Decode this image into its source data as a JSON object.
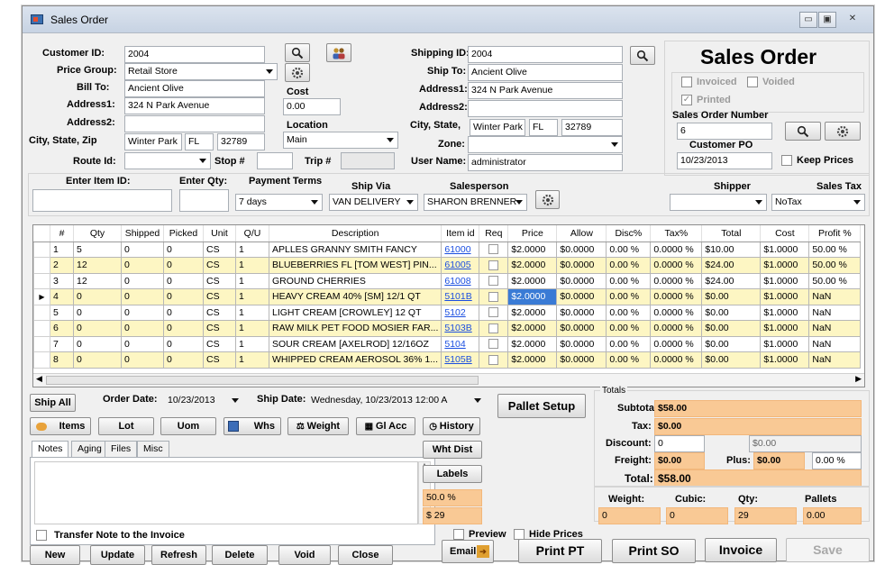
{
  "window": {
    "title": "Sales Order",
    "min_label": "▭",
    "max_label": "▣",
    "close_label": "✕"
  },
  "customer": {
    "id_label": "Customer ID:",
    "id": "2004",
    "price_group_label": "Price Group:",
    "price_group": "Retail Store",
    "bill_to_label": "Bill To:",
    "bill_to": "Ancient Olive",
    "address1_label": "Address1:",
    "address1": "324 N Park Avenue",
    "address2_label": "Address2:",
    "address2": "",
    "csz_label": "City, State, Zip",
    "city": "Winter Park",
    "state": "FL",
    "zip": "32789",
    "route_label": "Route Id:",
    "route": "",
    "stop_label": "Stop #",
    "stop": "",
    "trip_label": "Trip #",
    "trip": ""
  },
  "cost": {
    "label": "Cost",
    "value": "0.00",
    "location_label": "Location",
    "location": "Main"
  },
  "shipping": {
    "id_label": "Shipping ID:",
    "id": "2004",
    "ship_to_label": "Ship To:",
    "ship_to": "Ancient Olive",
    "address1_label": "Address1:",
    "address1": "324 N Park Avenue",
    "address2_label": "Address2:",
    "address2": "",
    "csz_label": "City, State,",
    "city": "Winter Park",
    "state": "FL",
    "zip": "32789",
    "zone_label": "Zone:",
    "zone": "",
    "username_label": "User Name:",
    "username": "administrator"
  },
  "order_panel": {
    "heading": "Sales Order",
    "invoiced": "Invoiced",
    "voided": "Voided",
    "printed": "Printed",
    "number_label": "Sales Order Number",
    "number": "6",
    "customer_po_label": "Customer PO",
    "customer_po": "10/23/2013",
    "keep_prices": "Keep Prices"
  },
  "entry": {
    "item_label": "Enter Item ID:",
    "qty_label": "Enter Qty:",
    "terms_label": "Payment Terms",
    "terms": "7 days",
    "ship_via_label": "Ship Via",
    "ship_via": "VAN DELIVERY",
    "salesperson_label": "Salesperson",
    "salesperson": "SHARON BRENNER",
    "shipper_label": "Shipper",
    "shipper": "",
    "sales_tax_label": "Sales Tax",
    "sales_tax": "NoTax"
  },
  "grid": {
    "columns": [
      "#",
      "Qty",
      "Shipped",
      "Picked",
      "Unit",
      "Q/U",
      "Description",
      "Item id",
      "Req",
      "Price",
      "Allow",
      "Disc%",
      "Tax%",
      "Total",
      "Cost",
      "Profit %"
    ],
    "rows": [
      [
        "1",
        "5",
        "0",
        "0",
        "CS",
        "1",
        "APLLES GRANNY SMITH FANCY",
        "61000",
        "",
        "$2.0000",
        "$0.0000",
        "0.00 %",
        "0.0000 %",
        "$10.00",
        "$1.0000",
        "50.00 %"
      ],
      [
        "2",
        "12",
        "0",
        "0",
        "CS",
        "1",
        "BLUEBERRIES FL [TOM WEST] PIN...",
        "61005",
        "",
        "$2.0000",
        "$0.0000",
        "0.00 %",
        "0.0000 %",
        "$24.00",
        "$1.0000",
        "50.00 %"
      ],
      [
        "3",
        "12",
        "0",
        "0",
        "CS",
        "1",
        "GROUND CHERRIES",
        "61008",
        "",
        "$2.0000",
        "$0.0000",
        "0.00 %",
        "0.0000 %",
        "$24.00",
        "$1.0000",
        "50.00 %"
      ],
      [
        "4",
        "0",
        "0",
        "0",
        "CS",
        "1",
        "HEAVY CREAM 40% [SM] 12/1 QT",
        "5101B",
        "",
        "$2.0000",
        "$0.0000",
        "0.00 %",
        "0.0000 %",
        "$0.00",
        "$1.0000",
        "NaN"
      ],
      [
        "5",
        "0",
        "0",
        "0",
        "CS",
        "1",
        "LIGHT CREAM [CROWLEY] 12 QT",
        "5102",
        "",
        "$2.0000",
        "$0.0000",
        "0.00 %",
        "0.0000 %",
        "$0.00",
        "$1.0000",
        "NaN"
      ],
      [
        "6",
        "0",
        "0",
        "0",
        "CS",
        "1",
        "RAW MILK PET FOOD MOSIER FAR...",
        "5103B",
        "",
        "$2.0000",
        "$0.0000",
        "0.00 %",
        "0.0000 %",
        "$0.00",
        "$1.0000",
        "NaN"
      ],
      [
        "7",
        "0",
        "0",
        "0",
        "CS",
        "1",
        "SOUR CREAM [AXELROD] 12/16OZ",
        "5104",
        "",
        "$2.0000",
        "$0.0000",
        "0.00 %",
        "0.0000 %",
        "$0.00",
        "$1.0000",
        "NaN"
      ],
      [
        "8",
        "0",
        "0",
        "0",
        "CS",
        "1",
        "WHIPPED CREAM AEROSOL 36% 1...",
        "5105B",
        "",
        "$2.0000",
        "$0.0000",
        "0.00 %",
        "0.0000 %",
        "$0.00",
        "$1.0000",
        "NaN"
      ]
    ],
    "selected_row_index": 3
  },
  "dates": {
    "ship_all": "Ship All",
    "order_date_label": "Order Date:",
    "order_date": "10/23/2013",
    "ship_date_label": "Ship Date:",
    "ship_date": "Wednesday, 10/23/2013 12:00 A",
    "pallet_setup": "Pallet Setup"
  },
  "toolbar": {
    "items": "Items",
    "lot": "Lot",
    "uom": "Uom",
    "whs": "Whs",
    "weight": "Weight",
    "gl_acc": "Gl Acc",
    "history": "History"
  },
  "tabs": [
    "Notes",
    "Aging",
    "Files",
    "Misc"
  ],
  "notes": {
    "value": "",
    "transfer_note": "Transfer Note to the Invoice"
  },
  "mid_buttons": {
    "wht_dist": "Wht Dist",
    "labels": "Labels",
    "percent": "50.0 %",
    "amount": "$ 29"
  },
  "preview": {
    "preview": "Preview",
    "hide_prices": "Hide Prices"
  },
  "totals": {
    "group_label": "Totals",
    "subtotal_label": "Subtotal:",
    "subtotal": "$58.00",
    "tax_label": "Tax:",
    "tax": "$0.00",
    "discount_label": "Discount:",
    "discount": "0",
    "discount_amount": "$0.00",
    "freight_label": "Freight:",
    "freight": "$0.00",
    "plus_label": "Plus:",
    "plus": "$0.00",
    "plus_pct": "0.00 %",
    "total_label": "Total:",
    "total": "$58.00"
  },
  "measures": {
    "weight_label": "Weight:",
    "weight": "0",
    "cubic_label": "Cubic:",
    "cubic": "0",
    "qty_label": "Qty:",
    "qty": "29",
    "pallets_label": "Pallets",
    "pallets": "0.00"
  },
  "bottom": {
    "new": "New",
    "update": "Update",
    "refresh": "Refresh",
    "delete": "Delete",
    "void": "Void",
    "close": "Close",
    "email": "Email",
    "print_pt": "Print PT",
    "print_so": "Print SO",
    "invoice": "Invoice",
    "save": "Save"
  },
  "colors": {
    "accent_field": "#f9c995",
    "row_alt": "#fdf6c3",
    "selection": "#3a7bd5",
    "link": "#1a4ee0"
  }
}
